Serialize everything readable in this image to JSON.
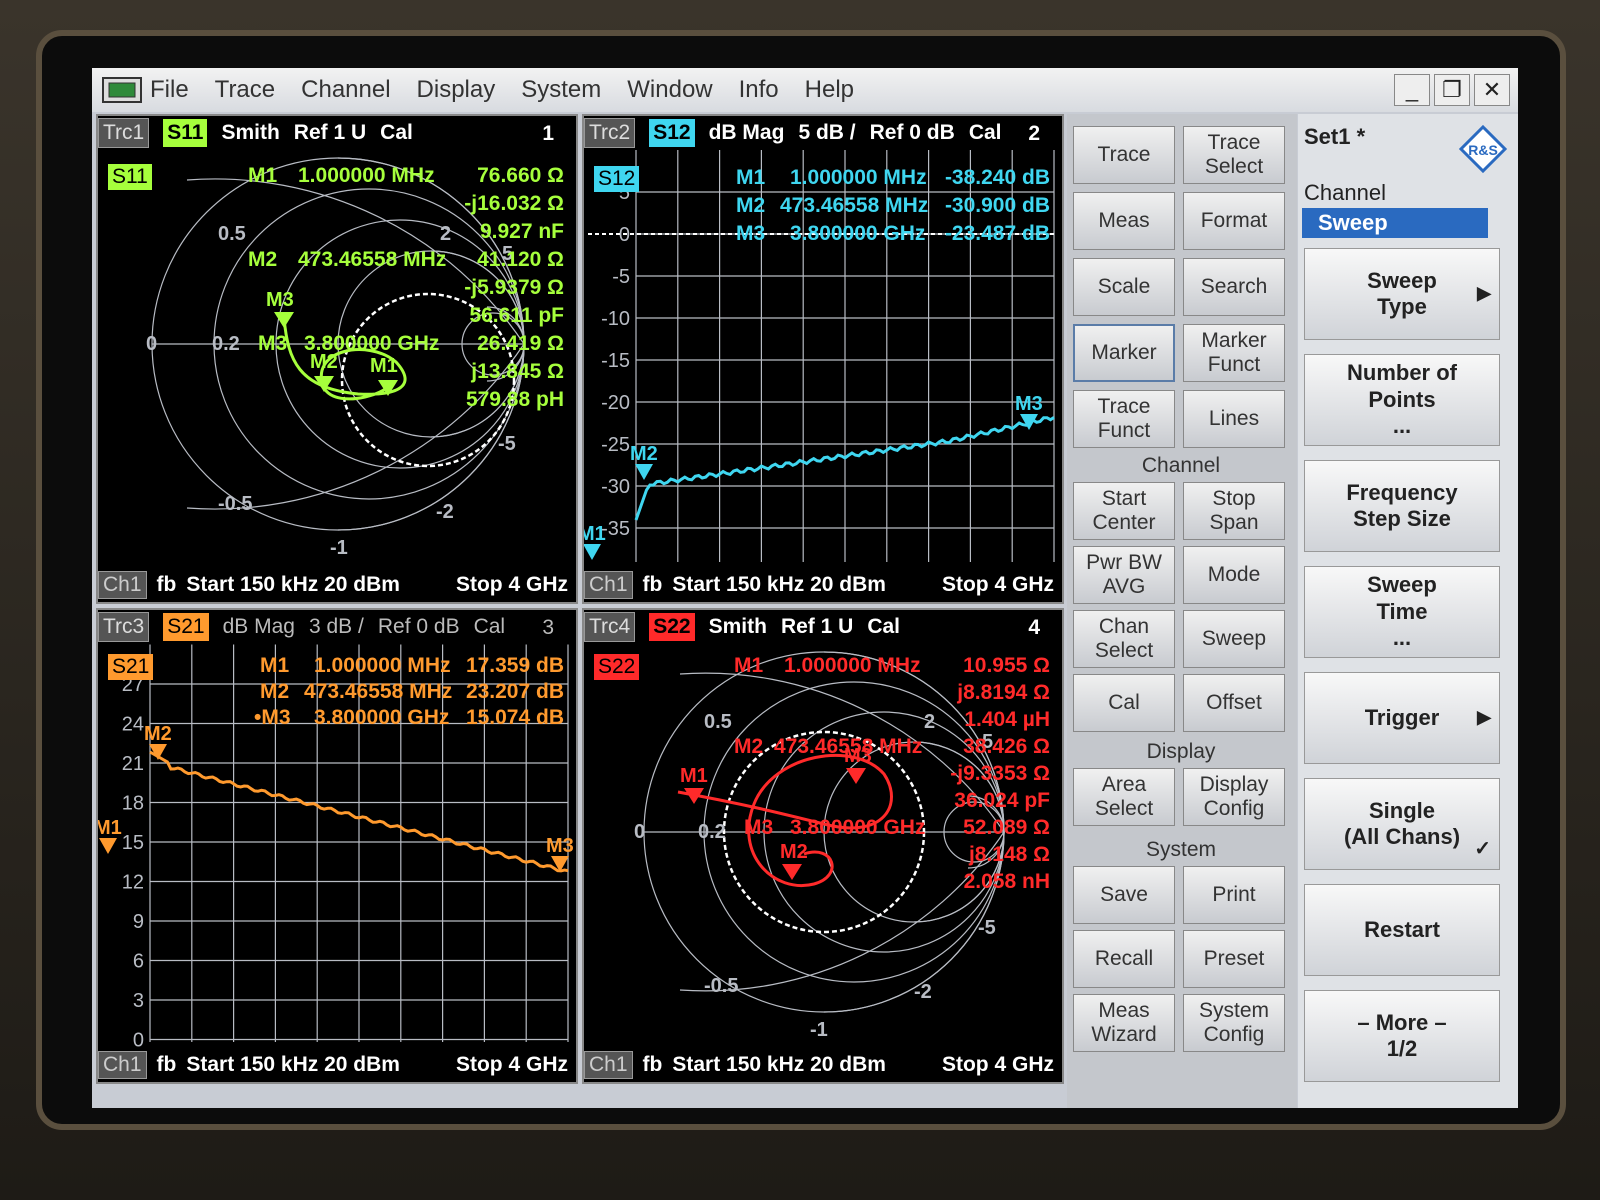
{
  "menubar": {
    "items": [
      "File",
      "Trace",
      "Channel",
      "Display",
      "System",
      "Window",
      "Info",
      "Help"
    ]
  },
  "colors": {
    "s11": "#a6ff3c",
    "s12": "#3fd6f0",
    "s21": "#ff9a2e",
    "s22": "#ff2a2a",
    "grid": "#b8bcc4"
  },
  "pane1": {
    "trc": "Trc1",
    "param": "S11",
    "fmt": "Smith",
    "ref": "Ref 1 U",
    "cal": "Cal",
    "num": "1",
    "badge": "S11",
    "markers": [
      {
        "id": "M1",
        "freq": "1.000000 MHz",
        "vals": [
          "76.660  Ω",
          "-j16.032  Ω",
          "9.927  nF"
        ]
      },
      {
        "id": "M2",
        "freq": "473.46558 MHz",
        "vals": [
          "41.120  Ω",
          "-j5.9379  Ω",
          "56.611  pF"
        ]
      },
      {
        "id": "M3",
        "freq": "3.800000 GHz",
        "vals": [
          "26.419  Ω",
          "j13.845  Ω",
          "579.88  pH"
        ]
      }
    ],
    "smith_labels": [
      "0.5",
      "0",
      "0.2",
      "2",
      "-0.5",
      "-1",
      "-2",
      "-5",
      "5"
    ],
    "marker_flags": [
      "M3",
      "M2",
      "M1"
    ],
    "footer": {
      "ch": "Ch1",
      "fb": "fb",
      "start": "Start  150 kHz 20 dBm",
      "stop": "Stop  4 GHz"
    }
  },
  "pane2": {
    "trc": "Trc2",
    "param": "S12",
    "fmt": "dB Mag",
    "div": "5 dB /",
    "ref": "Ref 0 dB",
    "cal": "Cal",
    "num": "2",
    "badge": "S12",
    "markers": [
      {
        "id": "M1",
        "freq": "1.000000 MHz",
        "val": "-38.240 dB"
      },
      {
        "id": "M2",
        "freq": "473.46558 MHz",
        "val": "-30.900 dB"
      },
      {
        "id": "M3",
        "freq": "3.800000 GHz",
        "val": "-23.487 dB"
      }
    ],
    "yticks": [
      "5",
      "0",
      "-5",
      "-10",
      "-15",
      "-20",
      "-25",
      "-30",
      "-35"
    ],
    "marker_flags": [
      "M1",
      "M2",
      "M3"
    ],
    "footer": {
      "ch": "Ch1",
      "fb": "fb",
      "start": "Start  150 kHz 20 dBm",
      "stop": "Stop  4 GHz"
    }
  },
  "pane3": {
    "trc": "Trc3",
    "param": "S21",
    "fmt": "dB Mag",
    "div": "3 dB /",
    "ref": "Ref 0 dB",
    "cal": "Cal",
    "num": "3",
    "badge": "S21",
    "markers": [
      {
        "id": "M1",
        "freq": "1.000000 MHz",
        "val": "17.359 dB"
      },
      {
        "id": "M2",
        "freq": "473.46558 MHz",
        "val": "23.207 dB"
      },
      {
        "id": "•M3",
        "freq": "3.800000 GHz",
        "val": "15.074 dB"
      }
    ],
    "yticks": [
      "27",
      "24",
      "21",
      "18",
      "15",
      "12",
      "9",
      "6",
      "3",
      "0"
    ],
    "marker_flags": [
      "M2",
      "M1",
      "M3"
    ],
    "footer": {
      "ch": "Ch1",
      "fb": "fb",
      "start": "Start  150 kHz 20 dBm",
      "stop": "Stop  4 GHz"
    }
  },
  "pane4": {
    "trc": "Trc4",
    "param": "S22",
    "fmt": "Smith",
    "ref": "Ref 1 U",
    "cal": "Cal",
    "num": "4",
    "badge": "S22",
    "markers": [
      {
        "id": "M1",
        "freq": "1.000000 MHz",
        "vals": [
          "10.955  Ω",
          "j8.8194  Ω",
          "1.404  µH"
        ]
      },
      {
        "id": "M2",
        "freq": "473.46558 MHz",
        "vals": [
          "38.426  Ω",
          "-j9.3353  Ω",
          "36.024  pF"
        ]
      },
      {
        "id": "M3",
        "freq": "3.800000 GHz",
        "vals": [
          "52.089  Ω",
          "j8.148  Ω",
          "2.058  nH"
        ]
      }
    ],
    "smith_labels": [
      "0.5",
      "0",
      "0.2",
      "2",
      "-0.5",
      "-1",
      "-2",
      "-5",
      "5"
    ],
    "marker_flags": [
      "M1",
      "M2",
      "M3"
    ],
    "footer": {
      "ch": "Ch1",
      "fb": "fb",
      "start": "Start  150 kHz 20 dBm",
      "stop": "Stop  4 GHz"
    }
  },
  "softkeys": {
    "row1": [
      "Trace",
      "Trace\nSelect"
    ],
    "row2": [
      "Meas",
      "Format"
    ],
    "row3": [
      "Scale",
      "Search"
    ],
    "row4": [
      "Marker",
      "Marker\nFunct"
    ],
    "row5": [
      "Trace\nFunct",
      "Lines"
    ],
    "grp_channel": "Channel",
    "row6": [
      "Start\nCenter",
      "Stop\nSpan"
    ],
    "row7": [
      "Pwr BW\nAVG",
      "Mode"
    ],
    "row8": [
      "Chan\nSelect",
      "Sweep"
    ],
    "row9": [
      "Cal",
      "Offset"
    ],
    "grp_display": "Display",
    "row10": [
      "Area\nSelect",
      "Display\nConfig"
    ],
    "grp_system": "System",
    "row11": [
      "Save",
      "Print"
    ],
    "row12": [
      "Recall",
      "Preset"
    ],
    "row13": [
      "Meas\nWizard",
      "System\nConfig"
    ]
  },
  "menupanel": {
    "set": "Set1 *",
    "crumb": "Channel",
    "selected": "Sweep",
    "buttons": [
      "Sweep\nType",
      "Number of\nPoints\n...",
      "Frequency\nStep Size",
      "Sweep\nTime\n...",
      "Trigger",
      "Single\n(All Chans)",
      "Restart",
      "– More –\n1/2"
    ]
  }
}
